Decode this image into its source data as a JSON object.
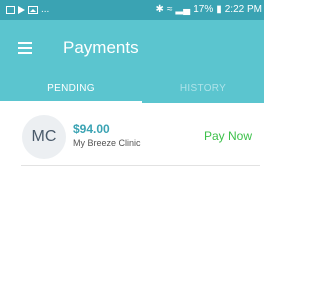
{
  "status_bar": {
    "left_dots": "...",
    "bluetooth_icon": "bluetooth-icon",
    "wifi_icon": "wifi-icon",
    "signal_icon": "signal-icon",
    "battery_percent": "17%",
    "battery_icon": "battery-icon",
    "time": "2:22 PM"
  },
  "app_bar": {
    "menu_icon": "hamburger-menu-icon",
    "title": "Payments",
    "background_color": "#5bc5cf"
  },
  "tabs": [
    {
      "label": "PENDING",
      "selected": true
    },
    {
      "label": "HISTORY",
      "selected": false
    }
  ],
  "payments": [
    {
      "avatar_initials": "MC",
      "amount": "$94.00",
      "provider": "My Breeze Clinic",
      "action_label": "Pay Now"
    }
  ],
  "colors": {
    "accent": "#5bc5cf",
    "status_bar": "#3aa3b3",
    "amount": "#3aa3b3",
    "pay_now": "#3cc14a"
  }
}
